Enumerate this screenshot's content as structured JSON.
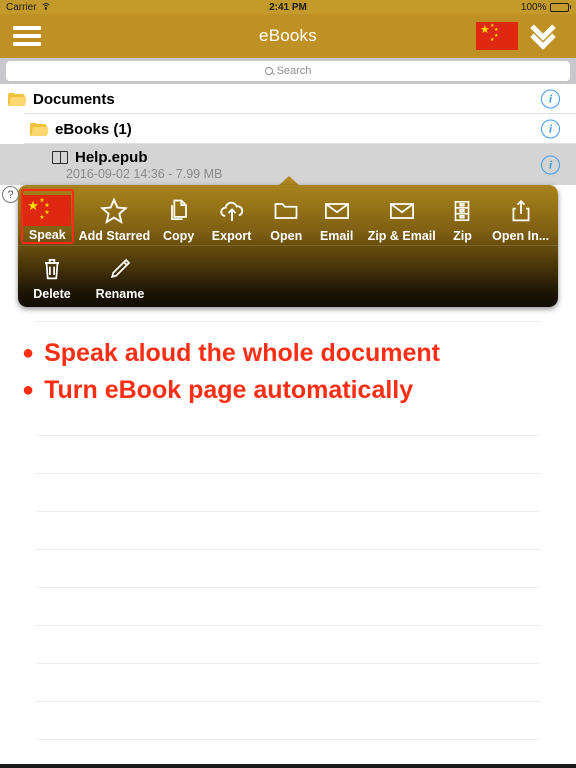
{
  "status_bar": {
    "carrier": "Carrier",
    "wifi_icon": "wifi-icon",
    "time": "2:41 PM",
    "battery_percent": "100%",
    "battery_icon": "battery-full-icon"
  },
  "nav_bar": {
    "menu_icon": "hamburger-icon",
    "title": "eBooks",
    "flag_icon": "china-flag-icon",
    "collapse_icon": "double-chevron-down-icon",
    "background_color": "#bf9023"
  },
  "search": {
    "placeholder": "Search",
    "value": "",
    "icon": "search-icon"
  },
  "file_list": {
    "rows": [
      {
        "icon": "folder-icon",
        "name": "Documents",
        "detail": "",
        "indent": 8,
        "selected": false,
        "info_icon": "info-circle-icon"
      },
      {
        "icon": "folder-icon",
        "name": "eBooks (1)",
        "detail": "",
        "indent": 30,
        "selected": false,
        "info_icon": "info-circle-icon"
      },
      {
        "icon": "book-icon",
        "name": "Help.epub",
        "detail": "2016-09-02 14:36 - 7.99 MB",
        "indent": 52,
        "selected": true,
        "info_icon": "info-circle-icon"
      }
    ]
  },
  "action_menu": {
    "help_badge": "?",
    "highlight_color": "#ff2a17",
    "row1": [
      {
        "label": "Speak",
        "icon": "china-flag-icon",
        "highlighted": true
      },
      {
        "label": "Add Starred",
        "icon": "star-icon",
        "highlighted": false
      },
      {
        "label": "Copy",
        "icon": "copy-icon",
        "highlighted": false
      },
      {
        "label": "Export",
        "icon": "cloud-upload-icon",
        "highlighted": false
      },
      {
        "label": "Open",
        "icon": "folder-open-icon",
        "highlighted": false
      },
      {
        "label": "Email",
        "icon": "envelope-icon",
        "highlighted": false
      },
      {
        "label": "Zip & Email",
        "icon": "envelope-icon",
        "highlighted": false
      },
      {
        "label": "Zip",
        "icon": "archive-icon",
        "highlighted": false
      },
      {
        "label": "Open In...",
        "icon": "share-icon",
        "highlighted": false
      }
    ],
    "row2": [
      {
        "label": "Delete",
        "icon": "trash-icon",
        "highlighted": false
      },
      {
        "label": "Rename",
        "icon": "pencil-icon",
        "highlighted": false
      }
    ]
  },
  "annotations": {
    "color": "#fa2e14",
    "bullets": [
      "Speak aloud the whole document",
      "Turn eBook page automatically"
    ]
  }
}
